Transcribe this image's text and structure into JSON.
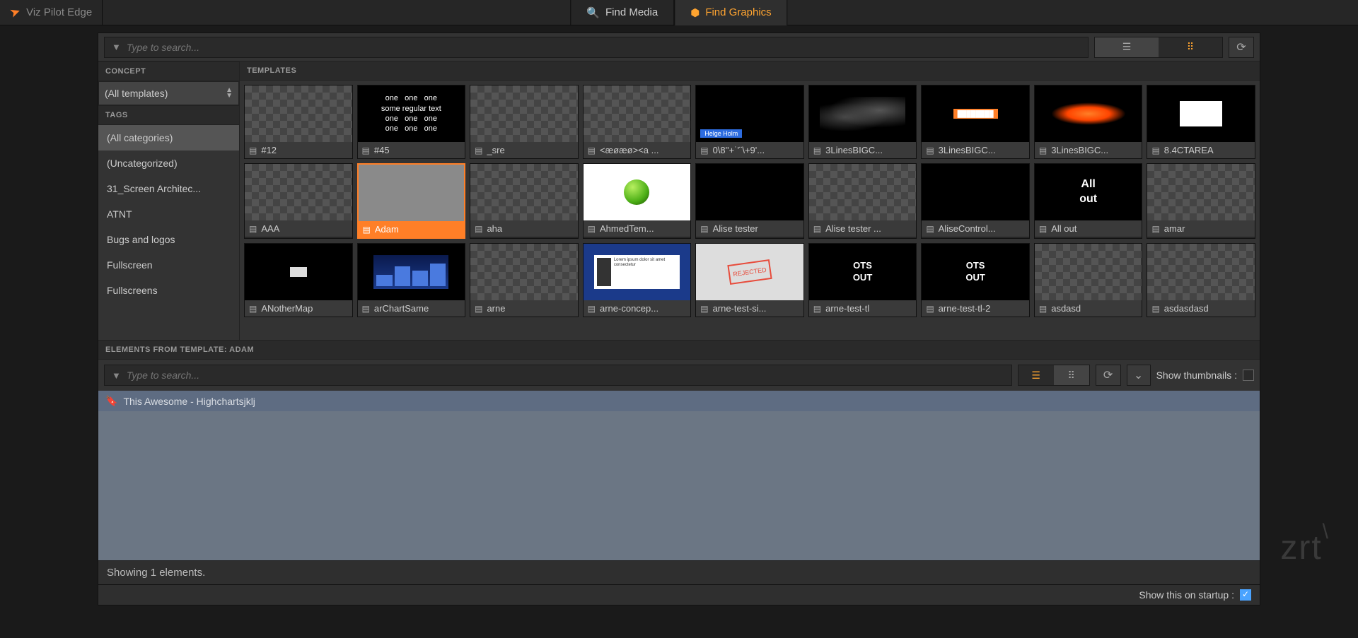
{
  "app_title": "Viz Pilot Edge",
  "tabs": {
    "media": "Find Media",
    "graphics": "Find Graphics"
  },
  "search": {
    "placeholder": "Type to search..."
  },
  "sidebar": {
    "concept_header": "CONCEPT",
    "concept_value": "(All templates)",
    "tags_header": "TAGS",
    "tags": [
      "(All categories)",
      "(Uncategorized)",
      "31_Screen Architec...",
      "ATNT",
      "Bugs and logos",
      "Fullscreen",
      "Fullscreens"
    ]
  },
  "templates_header": "TEMPLATES",
  "templates": [
    {
      "label": "#12",
      "thumb": "checker"
    },
    {
      "label": "#45",
      "thumb": "text45"
    },
    {
      "label": "_sre",
      "thumb": "checker"
    },
    {
      "label": "<æøæø><a ...",
      "thumb": "checker"
    },
    {
      "label": "0\\8''+˙'¨\\+9'...",
      "thumb": "helge"
    },
    {
      "label": "3LinesBIGC...",
      "thumb": "smoke"
    },
    {
      "label": "3LinesBIGC...",
      "thumb": "orangebar"
    },
    {
      "label": "3LinesBIGC...",
      "thumb": "orangefire"
    },
    {
      "label": "8.4CTAREA",
      "thumb": "ctarea"
    },
    {
      "label": "AAA",
      "thumb": "checker"
    },
    {
      "label": "Adam",
      "thumb": "grey",
      "selected": true
    },
    {
      "label": "aha",
      "thumb": "checker"
    },
    {
      "label": "AhmedTem...",
      "thumb": "sphere"
    },
    {
      "label": "Alise tester",
      "thumb": "black"
    },
    {
      "label": "Alise tester ...",
      "thumb": "checker"
    },
    {
      "label": "AliseControl...",
      "thumb": "black"
    },
    {
      "label": "All out",
      "thumb": "allout"
    },
    {
      "label": "amar",
      "thumb": "checker"
    },
    {
      "label": "ANotherMap",
      "thumb": "map"
    },
    {
      "label": "arChartSame",
      "thumb": "bluechart"
    },
    {
      "label": "arne",
      "thumb": "checker"
    },
    {
      "label": "arne-concep...",
      "thumb": "bluecard"
    },
    {
      "label": "arne-test-si...",
      "thumb": "stamp"
    },
    {
      "label": "arne-test-tl",
      "thumb": "otsout"
    },
    {
      "label": "arne-test-tl-2",
      "thumb": "otsout"
    },
    {
      "label": "asdasd",
      "thumb": "checker"
    },
    {
      "label": "asdasdasd",
      "thumb": "checker"
    }
  ],
  "elements": {
    "header": "ELEMENTS FROM TEMPLATE: ADAM",
    "search_placeholder": "Type to search...",
    "show_thumbnails": "Show thumbnails :",
    "items": [
      "This Awesome - Highchartsjklj"
    ]
  },
  "status": "Showing 1 elements.",
  "startup_label": "Show this on startup :",
  "watermark": "zrt"
}
